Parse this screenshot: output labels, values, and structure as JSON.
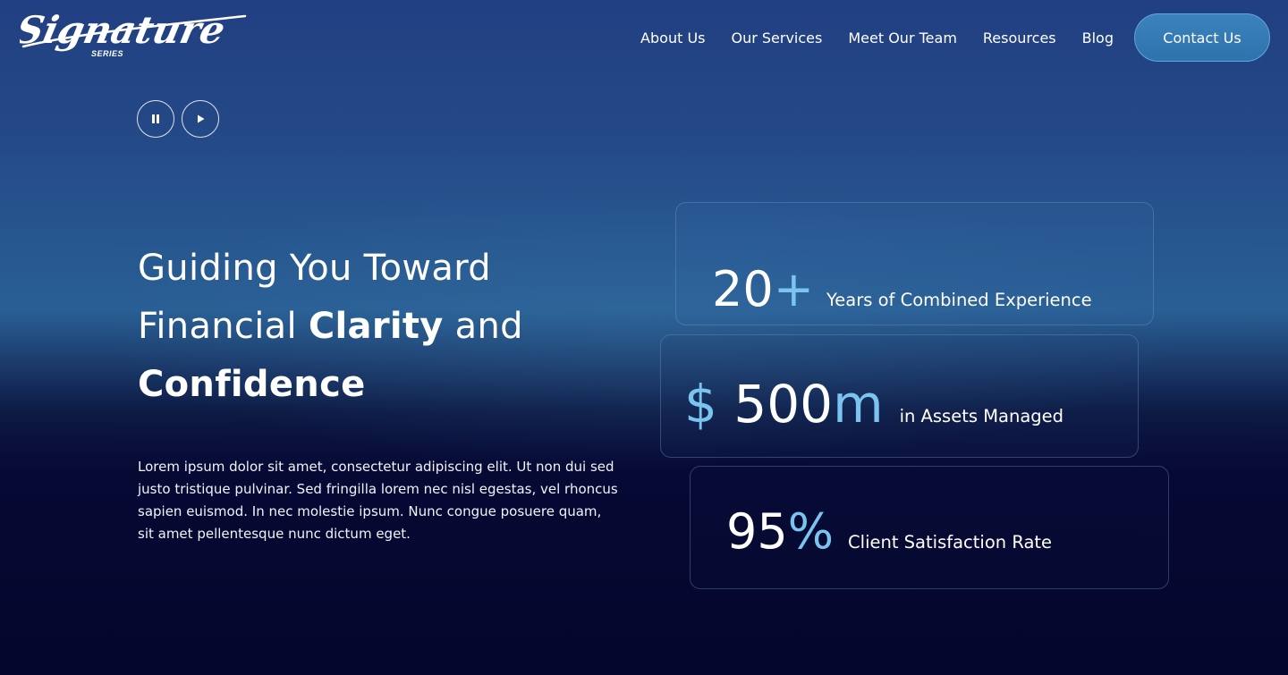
{
  "brand": {
    "logo_script": "Signature",
    "logo_sub": "SERIES"
  },
  "nav": {
    "items": [
      "About Us",
      "Our Services",
      "Meet Our Team",
      "Resources",
      "Blog"
    ],
    "contact_label": "Contact Us"
  },
  "media": {
    "pause_icon": "pause-icon",
    "play_icon": "play-icon"
  },
  "hero": {
    "headline_line1": "Guiding You Toward",
    "headline_line2_pre": "Financial ",
    "headline_line2_bold": "Clarity",
    "headline_line2_post": " and",
    "headline_line3_bold": "Confidence",
    "body": "Lorem ipsum dolor sit amet, consectetur adipiscing elit. Ut non dui sed justo tristique pulvinar. Sed fringilla lorem nec nisl egestas, vel rhoncus sapien euismod. In nec molestie ipsum. Nunc congue posuere quam, sit amet pellentesque nunc dictum eget."
  },
  "stats": [
    {
      "prefix": "",
      "number": "20",
      "suffix": "+",
      "label": "Years of Combined Experience"
    },
    {
      "prefix": "$ ",
      "number": "500",
      "suffix": "m",
      "label": "in Assets Managed"
    },
    {
      "prefix": "",
      "number": "95",
      "suffix": "%",
      "label": "Client Satisfaction Rate"
    }
  ],
  "colors": {
    "accent": "#7cc4f0",
    "button": "#3378b4",
    "background_top": "#213f82",
    "background_bottom": "#05062d"
  }
}
